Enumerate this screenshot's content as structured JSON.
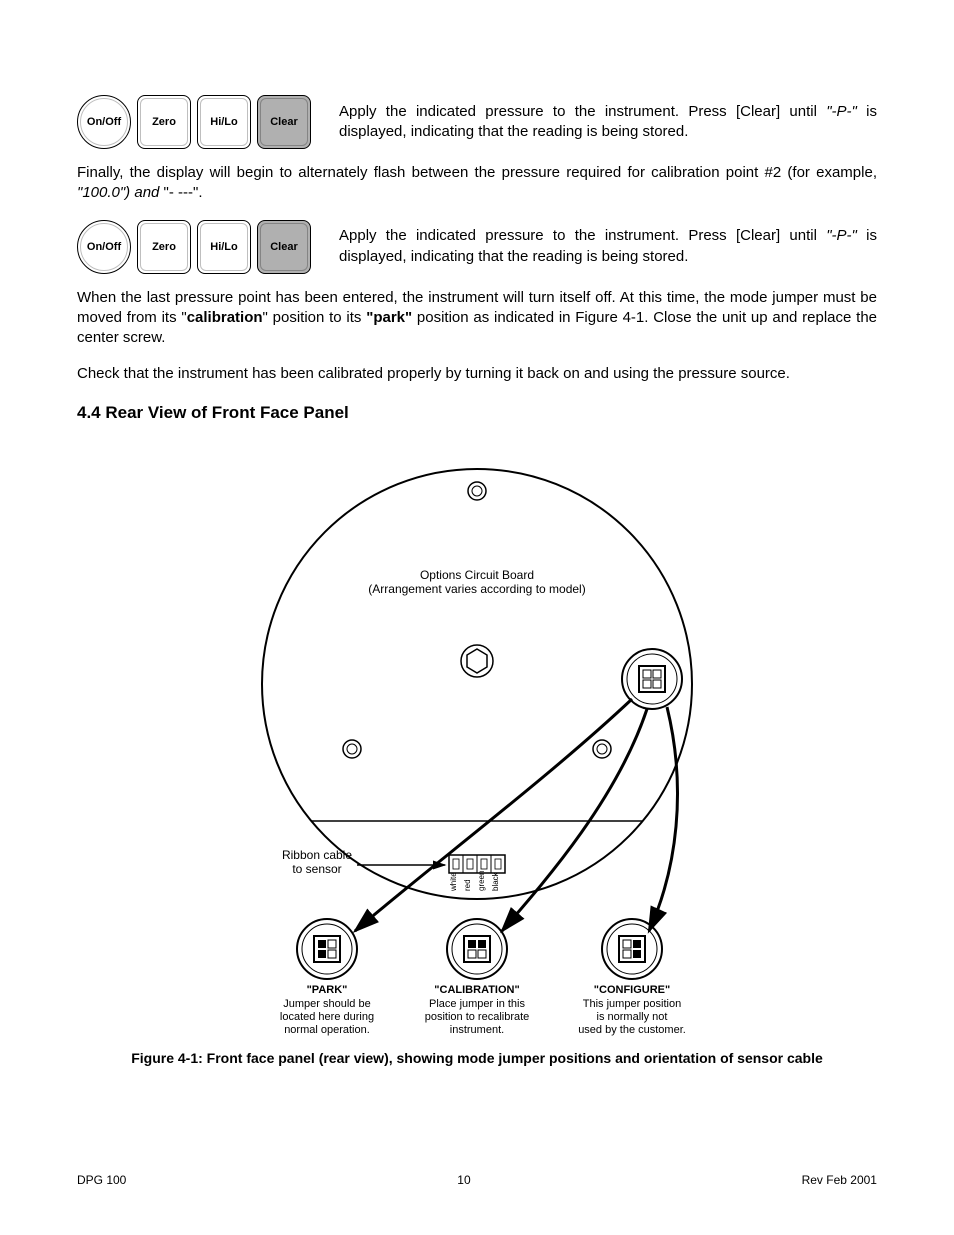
{
  "buttons": {
    "onoff": "On/Off",
    "zero": "Zero",
    "hilo": "Hi/Lo",
    "clear": "Clear"
  },
  "text": {
    "apply_pressure": "Apply the indicated pressure to the instrument. Press [Clear] until ",
    "apply_pressure_p": "\"-P-\"",
    "apply_pressure_tail": " is displayed, indicating that the reading is being stored.",
    "finally1": "Finally, the display will begin to alternately flash between the pressure required for calibration point #2 (for example, ",
    "finally_italic": "\"100.0\") and ",
    "finally_tail": " \"- ---\".",
    "when_last_a": "When the last pressure point has been entered, the instrument will turn itself off. At this time, the mode jumper must be moved from its \"",
    "when_last_b_bold": "calibration",
    "when_last_c": "\" position to its ",
    "when_last_d_bold": "\"park\"",
    "when_last_e": " position as indicated in Figure 4-1. Close the unit up and replace the center screw.",
    "check": "Check that the instrument has been calibrated properly by turning it back on and using the pressure source.",
    "section_heading": "4.4    Rear View of Front Face Panel",
    "fig_caption": "Figure 4-1: Front face panel (rear view), showing mode jumper positions and orientation of sensor cable"
  },
  "diagram": {
    "options_board_line1": "Options Circuit Board",
    "options_board_line2": "(Arrangement varies according to model)",
    "ribbon_line1": "Ribbon cable",
    "ribbon_line2": "to sensor",
    "pins": {
      "p1": "white",
      "p2": "red",
      "p3": "green",
      "p4": "black"
    },
    "park": {
      "title": "\"PARK\"",
      "l1": "Jumper should be",
      "l2": "located here during",
      "l3": "normal operation."
    },
    "cal": {
      "title": "\"CALIBRATION\"",
      "l1": "Place jumper in this",
      "l2": "position to recalibrate",
      "l3": "instrument."
    },
    "conf": {
      "title": "\"CONFIGURE\"",
      "l1": "This jumper position",
      "l2": "is normally not",
      "l3": "used by the customer."
    }
  },
  "footer": {
    "left": "DPG 100",
    "center": "10",
    "right": "Rev Feb 2001"
  }
}
